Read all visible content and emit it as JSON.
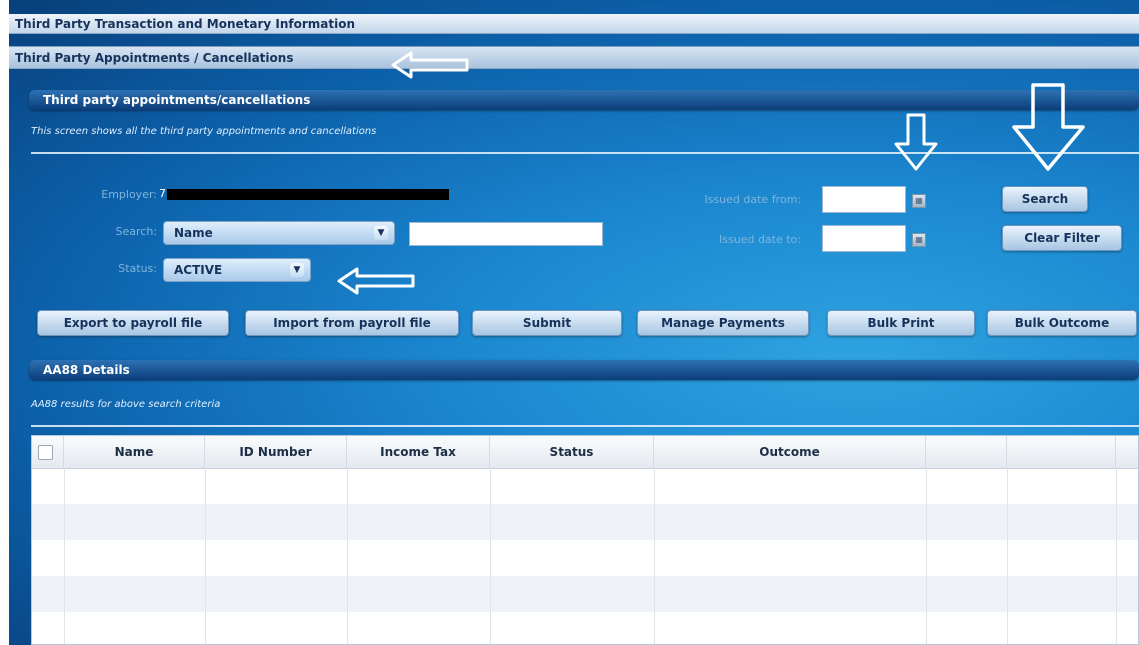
{
  "nav": {
    "menu_item_1": "Third Party Transaction and Monetary Information",
    "menu_item_2": "Third Party Appointments / Cancellations"
  },
  "section1": {
    "title": "Third party appointments/cancellations",
    "subtitle": "This screen shows all the third party appointments and cancellations"
  },
  "filters": {
    "employer_label": "Employer:",
    "employer_value": "7",
    "search_label": "Search:",
    "search_option": "Name",
    "search_value": "",
    "status_label": "Status:",
    "status_option": "ACTIVE",
    "issued_from_label": "Issued date from:",
    "issued_from_value": "",
    "issued_to_label": "Issued date to:",
    "issued_to_value": "",
    "search_button": "Search",
    "clear_button": "Clear Filter"
  },
  "actions": {
    "export": "Export to payroll file",
    "import": "Import from payroll file",
    "submit": "Submit",
    "manage": "Manage Payments",
    "bulk_print": "Bulk Print",
    "bulk_outcome": "Bulk Outcome"
  },
  "section2": {
    "title": "AA88 Details",
    "subtitle": "AA88 results for above search criteria"
  },
  "table": {
    "columns": [
      "Name",
      "ID Number",
      "Income Tax",
      "Status",
      "Outcome",
      "",
      "",
      ""
    ],
    "rows": []
  },
  "colors": {
    "background": "#1a86cf",
    "header_bar": "#0c3d78",
    "button": "#a7c5e2",
    "annotation_arrow": "#ffffff"
  }
}
